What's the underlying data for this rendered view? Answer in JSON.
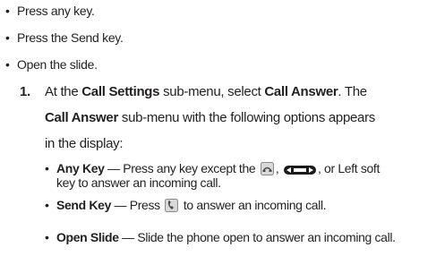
{
  "top_bullets": [
    "Press any key.",
    "Press the Send key.",
    "Open the slide."
  ],
  "step": {
    "number": "1.",
    "line1_pre": "At the ",
    "line1_b1": "Call Settings",
    "line1_mid": " sub-menu, select ",
    "line1_b2": "Call Answer",
    "line1_post": ". The",
    "line2_b": "Call Answer",
    "line2_post": " sub-menu with the following options appears",
    "line3": "in the display:"
  },
  "options": [
    {
      "name": "Any Key",
      "desc_pre": " — Press any key except the ",
      "desc_mid1": ", ",
      "desc_mid2": ", or Left soft",
      "desc_cont": "key to answer an incoming call."
    },
    {
      "name": "Send Key",
      "desc_pre": " — Press ",
      "desc_post": " to answer an incoming call."
    },
    {
      "name": "Open Slide",
      "desc": " — Slide the phone open to answer an incoming call."
    }
  ],
  "icons": {
    "end_key": "end-key-icon",
    "nav_key": "navigation-key-icon",
    "send_key": "send-key-icon"
  }
}
